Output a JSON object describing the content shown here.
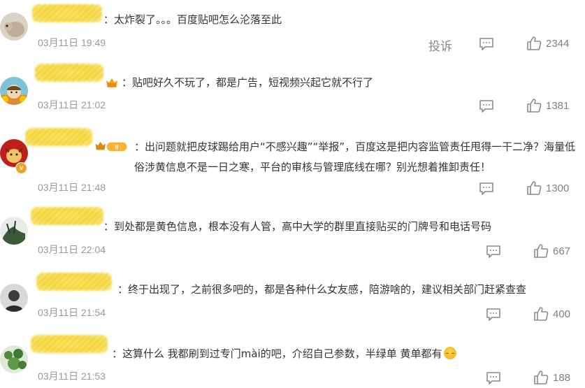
{
  "actions": {
    "report_label": "投诉"
  },
  "comments": [
    {
      "text": "：太炸裂了。。。百度贴吧怎么沦落至此",
      "date": "03月11日 19:49",
      "likes": "2344"
    },
    {
      "text": "：贴吧好久不玩了，都是广告，短视频兴起它就不行了",
      "date": "03月11日 21:02",
      "likes": "1381"
    },
    {
      "text": "：出问题就把皮球踢给用户“不感兴趣”“举报”，百度这是把内容监管责任甩得一干二净？海量低俗涉黄信息不是一日之寒，平台的审核与管理底线在哪？别光想着推卸责任！",
      "date": "03月11日 21:48",
      "likes": "1300",
      "level_badge": "II"
    },
    {
      "text": "：到处都是黄色信息，根本没有人管，高中大学的群里直接贴买的门牌号和电话号码",
      "date": "03月11日 22:04",
      "likes": "667"
    },
    {
      "text": "：终于出现了，之前很多吧的，都是各种什么女友感，陪游啥的，建议相关部门赶紧查查",
      "date": "03月11日 21:54",
      "likes": "400"
    },
    {
      "text": "：这算什么 我都刷到过专门mài的吧，介绍自己参数，半绿单 黄单都有",
      "date": "03月11日 21:53",
      "likes": "188"
    }
  ],
  "icons": {
    "comment": "comment-bubble-icon",
    "like": "thumbs-up-icon",
    "verified": "verified-v-badge",
    "vip": "crown-vip-badge",
    "emoji": "crying-laughing-emoji"
  },
  "colors": {
    "text": "#333333",
    "meta": "#999999",
    "icon": "#8a8a8a",
    "mask": "#f5d43a",
    "vip": "#f0a21f"
  }
}
